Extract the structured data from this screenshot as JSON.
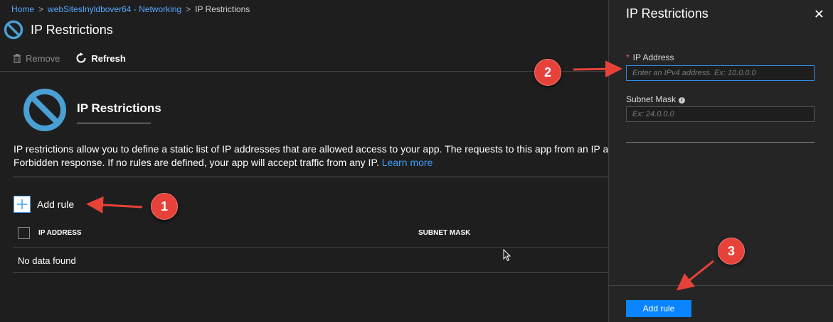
{
  "breadcrumb": {
    "items": [
      "Home",
      "webSitesInyldbover64 - Networking",
      "IP Restrictions"
    ],
    "separator": ">"
  },
  "blade": {
    "title": "IP Restrictions"
  },
  "toolbar": {
    "remove_label": "Remove",
    "refresh_label": "Refresh"
  },
  "hero": {
    "title": "IP Restrictions",
    "description_line1": "IP restrictions allow you to define a static list of IP addresses that are allowed access to your app. The requests to this app from an IP add",
    "description_line2": "Forbidden response. If no rules are defined, your app will accept traffic from any IP.",
    "learn_more": "Learn more"
  },
  "rules": {
    "add_label": "Add rule",
    "columns": [
      "IP ADDRESS",
      "SUBNET MASK"
    ],
    "empty_text": "No data found"
  },
  "panel": {
    "title": "IP Restrictions",
    "close_glyph": "✕",
    "required_marker": "*",
    "ip_label": "IP Address",
    "ip_placeholder": "Enter an IPv4 address. Ex: 10.0.0.0",
    "mask_label": "Subnet Mask",
    "mask_placeholder": "Ex: 24.0.0.0",
    "add_button": "Add rule"
  },
  "annotations": [
    "1",
    "2",
    "3"
  ],
  "colors": {
    "accent": "#0a84ff",
    "link": "#3aa0ff",
    "annotation": "#e6423a",
    "blocked_icon": "#4a9fd4"
  },
  "icons": {
    "blocked": "blocked-icon",
    "trash": "trash-icon",
    "refresh": "refresh-icon",
    "plus": "plus-icon",
    "info": "info-icon",
    "close": "close-icon"
  }
}
